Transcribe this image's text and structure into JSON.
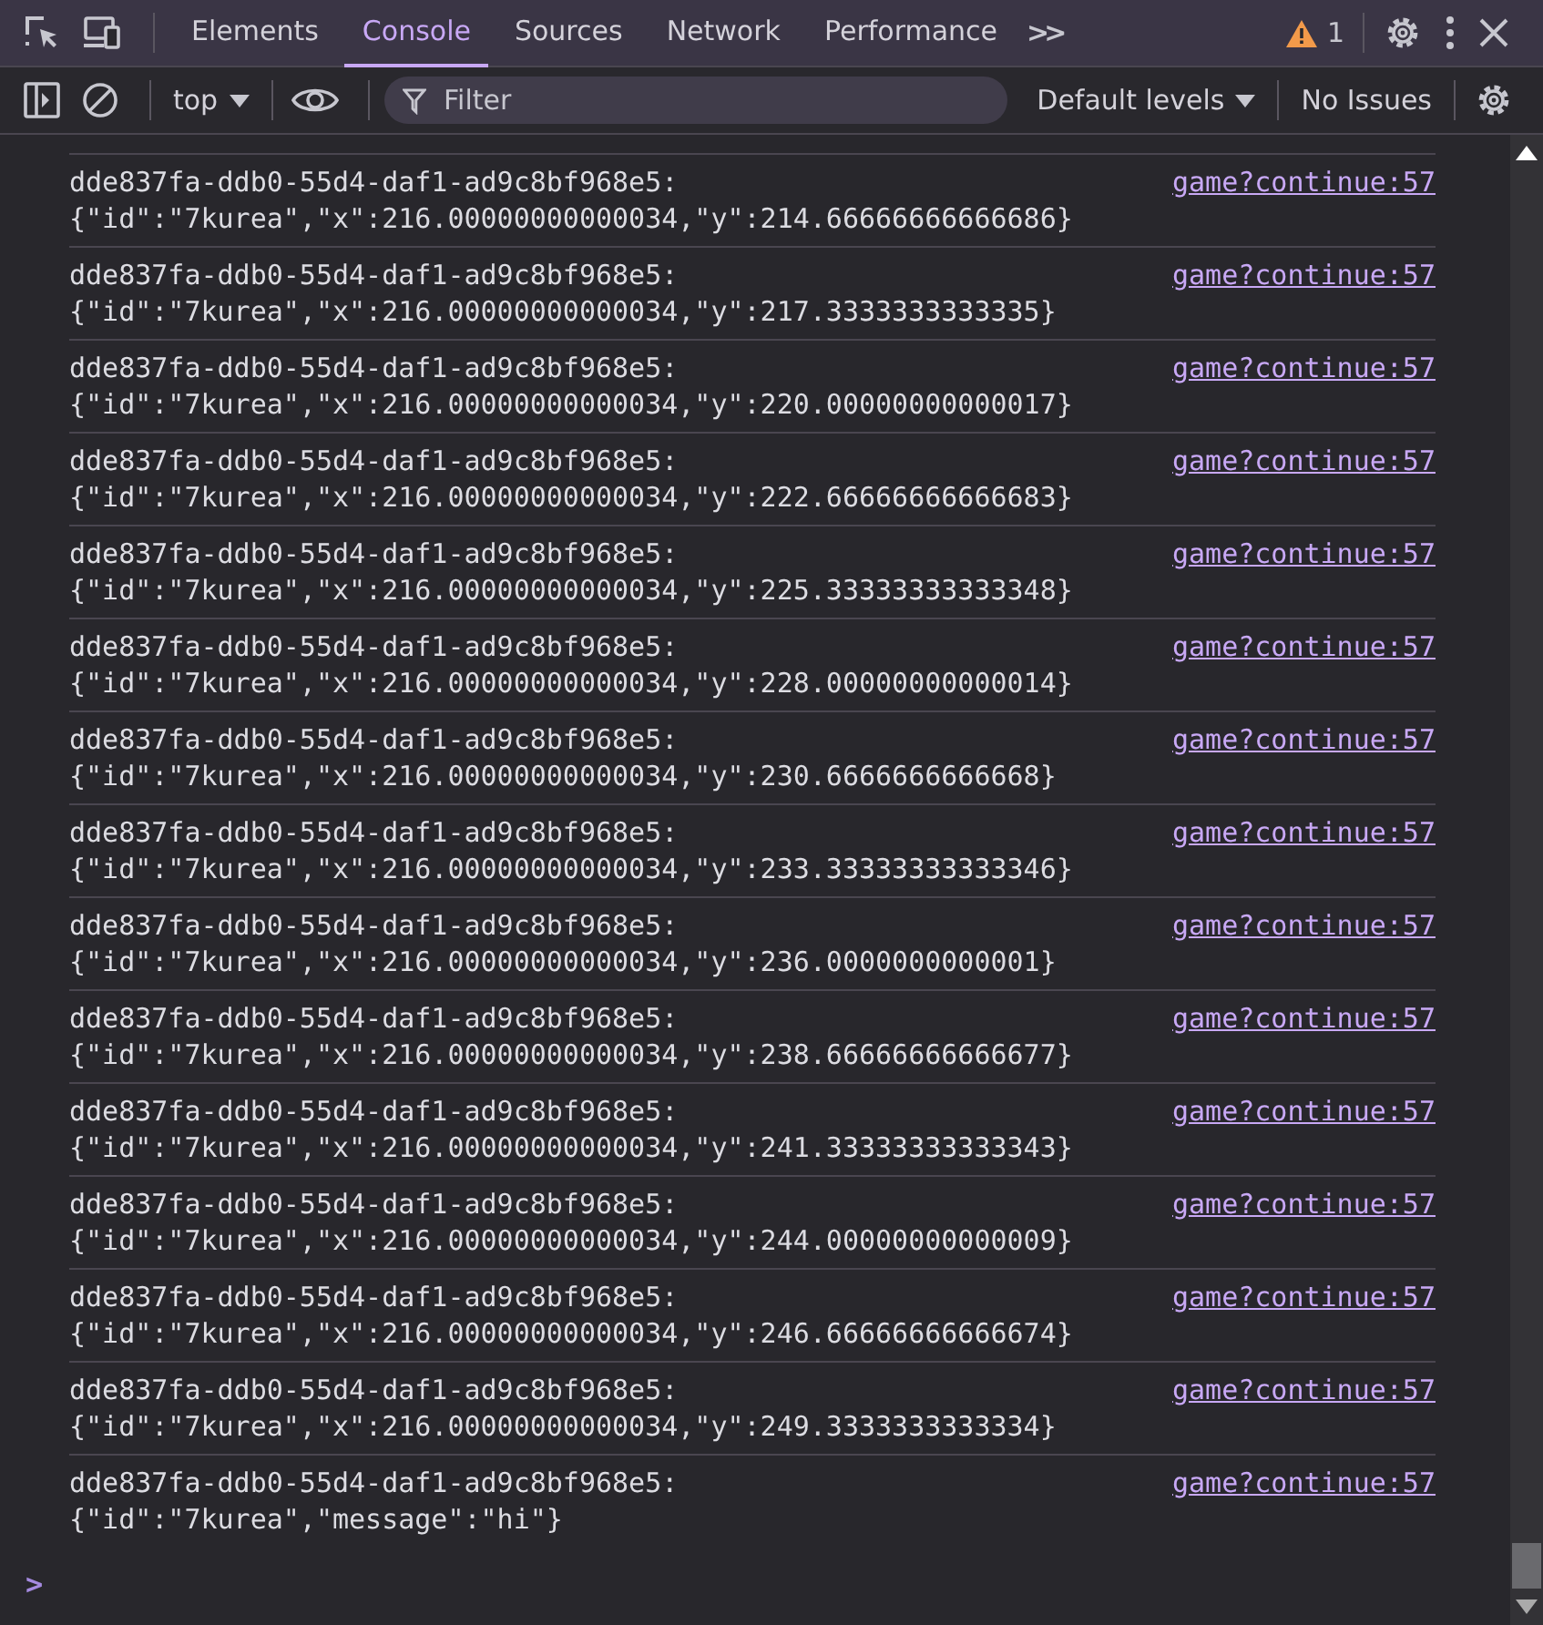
{
  "tabs": [
    {
      "label": "Elements",
      "selected": false
    },
    {
      "label": "Console",
      "selected": true
    },
    {
      "label": "Sources",
      "selected": false
    },
    {
      "label": "Network",
      "selected": false
    },
    {
      "label": "Performance",
      "selected": false
    }
  ],
  "more_tabs": ">>",
  "warnings": "1",
  "console_toolbar": {
    "context": "top",
    "filter_placeholder": "Filter",
    "levels": "Default levels",
    "issues": "No Issues"
  },
  "messages": [
    {
      "prefix": "dde837fa-ddb0-55d4-daf1-ad9c8bf968e5:",
      "body": "{\"id\":\"7kurea\",\"x\":216.00000000000034,\"y\":214.66666666666686}",
      "source": "game?continue:57"
    },
    {
      "prefix": "dde837fa-ddb0-55d4-daf1-ad9c8bf968e5:",
      "body": "{\"id\":\"7kurea\",\"x\":216.00000000000034,\"y\":217.3333333333335}",
      "source": "game?continue:57"
    },
    {
      "prefix": "dde837fa-ddb0-55d4-daf1-ad9c8bf968e5:",
      "body": "{\"id\":\"7kurea\",\"x\":216.00000000000034,\"y\":220.00000000000017}",
      "source": "game?continue:57"
    },
    {
      "prefix": "dde837fa-ddb0-55d4-daf1-ad9c8bf968e5:",
      "body": "{\"id\":\"7kurea\",\"x\":216.00000000000034,\"y\":222.66666666666683}",
      "source": "game?continue:57"
    },
    {
      "prefix": "dde837fa-ddb0-55d4-daf1-ad9c8bf968e5:",
      "body": "{\"id\":\"7kurea\",\"x\":216.00000000000034,\"y\":225.33333333333348}",
      "source": "game?continue:57"
    },
    {
      "prefix": "dde837fa-ddb0-55d4-daf1-ad9c8bf968e5:",
      "body": "{\"id\":\"7kurea\",\"x\":216.00000000000034,\"y\":228.00000000000014}",
      "source": "game?continue:57"
    },
    {
      "prefix": "dde837fa-ddb0-55d4-daf1-ad9c8bf968e5:",
      "body": "{\"id\":\"7kurea\",\"x\":216.00000000000034,\"y\":230.6666666666668}",
      "source": "game?continue:57"
    },
    {
      "prefix": "dde837fa-ddb0-55d4-daf1-ad9c8bf968e5:",
      "body": "{\"id\":\"7kurea\",\"x\":216.00000000000034,\"y\":233.33333333333346}",
      "source": "game?continue:57"
    },
    {
      "prefix": "dde837fa-ddb0-55d4-daf1-ad9c8bf968e5:",
      "body": "{\"id\":\"7kurea\",\"x\":216.00000000000034,\"y\":236.0000000000001}",
      "source": "game?continue:57"
    },
    {
      "prefix": "dde837fa-ddb0-55d4-daf1-ad9c8bf968e5:",
      "body": "{\"id\":\"7kurea\",\"x\":216.00000000000034,\"y\":238.66666666666677}",
      "source": "game?continue:57"
    },
    {
      "prefix": "dde837fa-ddb0-55d4-daf1-ad9c8bf968e5:",
      "body": "{\"id\":\"7kurea\",\"x\":216.00000000000034,\"y\":241.33333333333343}",
      "source": "game?continue:57"
    },
    {
      "prefix": "dde837fa-ddb0-55d4-daf1-ad9c8bf968e5:",
      "body": "{\"id\":\"7kurea\",\"x\":216.00000000000034,\"y\":244.00000000000009}",
      "source": "game?continue:57"
    },
    {
      "prefix": "dde837fa-ddb0-55d4-daf1-ad9c8bf968e5:",
      "body": "{\"id\":\"7kurea\",\"x\":216.00000000000034,\"y\":246.66666666666674}",
      "source": "game?continue:57"
    },
    {
      "prefix": "dde837fa-ddb0-55d4-daf1-ad9c8bf968e5:",
      "body": "{\"id\":\"7kurea\",\"x\":216.00000000000034,\"y\":249.3333333333334}",
      "source": "game?continue:57"
    },
    {
      "prefix": "dde837fa-ddb0-55d4-daf1-ad9c8bf968e5:",
      "body": "{\"id\":\"7kurea\",\"message\":\"hi\"}",
      "source": "game?continue:57"
    }
  ],
  "prompt": ">"
}
